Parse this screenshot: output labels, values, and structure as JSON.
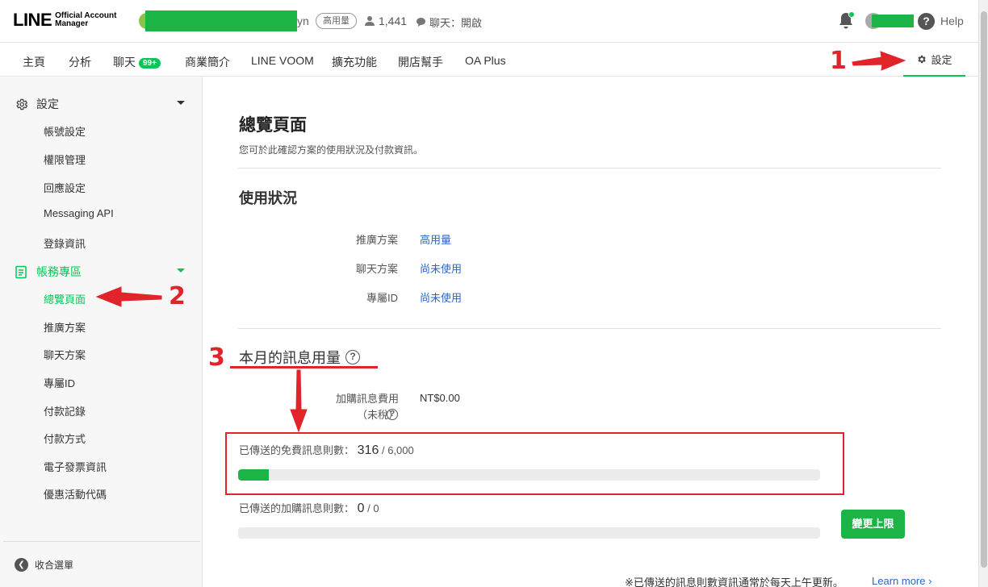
{
  "header": {
    "logo_main": "LINE",
    "logo_sub_1": "Official Account",
    "logo_sub_2": "Manager",
    "account_name_tail": "yn",
    "plan_badge": "高用量",
    "friends_count": "1,441",
    "chat_status": "聊天：開啟",
    "help_label": "Help"
  },
  "nav": {
    "items": [
      {
        "label": "主頁"
      },
      {
        "label": "分析"
      },
      {
        "label": "聊天",
        "badge": "99+"
      },
      {
        "label": "商業簡介"
      },
      {
        "label": "LINE VOOM"
      },
      {
        "label": "擴充功能"
      },
      {
        "label": "開店幫手"
      },
      {
        "label": "OA Plus"
      }
    ],
    "settings_label": "設定"
  },
  "sidebar": {
    "group_settings": "設定",
    "settings_items": [
      "帳號設定",
      "權限管理",
      "回應設定",
      "Messaging API",
      "登錄資訊"
    ],
    "group_billing": "帳務專區",
    "billing_items": [
      "總覽頁面",
      "推廣方案",
      "聊天方案",
      "專屬ID",
      "付款記錄",
      "付款方式",
      "電子發票資訊",
      "優惠活動代碼"
    ],
    "collapse_label": "收合選單"
  },
  "main": {
    "title": "總覽頁面",
    "subtitle": "您可於此確認方案的使用狀況及付款資訊。",
    "status_section": "使用狀況",
    "rows": [
      {
        "label": "推廣方案",
        "value": "高用量"
      },
      {
        "label": "聊天方案",
        "value": "尚未使用"
      },
      {
        "label": "專屬ID",
        "value": "尚未使用"
      }
    ],
    "usage_section": "本月的訊息用量",
    "fee_label_1": "加購訊息費用",
    "fee_label_2": "（未稅）",
    "fee_value": "NT$0.00",
    "free_label": "已傳送的免費訊息則數：",
    "free_count": "316",
    "free_total": "/ 6,000",
    "free_fraction": 0.0527,
    "paid_label": "已傳送的加購訊息則數：",
    "paid_count": "0",
    "paid_total": "/ 0",
    "paid_fraction": 0,
    "raise_button": "變更上限",
    "footnote": "※已傳送的訊息則數資訊通常於每天上午更新。",
    "learn_more": "Learn more"
  },
  "annotations": {
    "n1": "1",
    "n2": "2",
    "n3": "3",
    "color": "#e0242a"
  },
  "colors": {
    "brand_green": "#06c755",
    "link_blue": "#2b66c8"
  }
}
